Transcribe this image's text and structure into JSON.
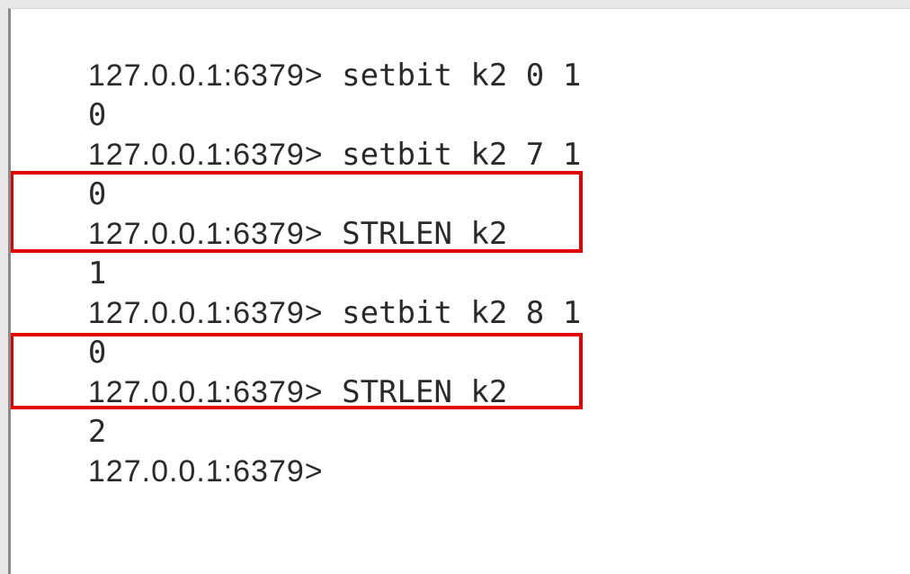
{
  "terminal": {
    "lines": [
      {
        "prompt": "127.0.0.1:6379>",
        "command": " setbit k2 0 1"
      },
      {
        "output": "0"
      },
      {
        "prompt": "127.0.0.1:6379>",
        "command": " setbit k2 7 1"
      },
      {
        "output": "0"
      },
      {
        "prompt": "127.0.0.1:6379>",
        "command": " STRLEN k2"
      },
      {
        "output": "1"
      },
      {
        "prompt": "127.0.0.1:6379>",
        "command": " setbit k2 8 1"
      },
      {
        "output": "0"
      },
      {
        "prompt": "127.0.0.1:6379>",
        "command": " STRLEN k2"
      },
      {
        "output": "2"
      },
      {
        "prompt": "127.0.0.1:6379>",
        "command": ""
      }
    ],
    "highlight_color": "#e00000"
  }
}
